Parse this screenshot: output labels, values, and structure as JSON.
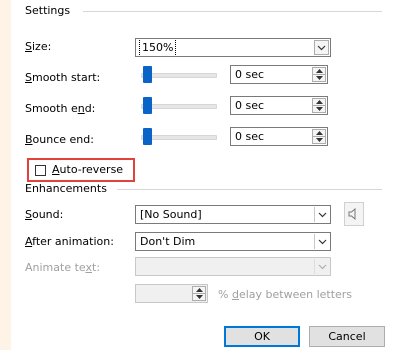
{
  "settings": {
    "group_label": "Settings",
    "size": {
      "label": "Size:",
      "value": "150%"
    },
    "smooth_start": {
      "label": "Smooth start:",
      "value": "0 sec",
      "level": 0
    },
    "smooth_end": {
      "label": "Smooth end:",
      "value": "0 sec",
      "level": 0
    },
    "bounce_end": {
      "label": "Bounce end:",
      "value": "0 sec",
      "level": 0
    },
    "auto_reverse": {
      "label": "Auto-reverse",
      "checked": false
    }
  },
  "enhancements": {
    "group_label": "Enhancements",
    "sound": {
      "label": "Sound:",
      "value": "[No Sound]"
    },
    "after_animation": {
      "label": "After animation:",
      "value": "Don't Dim"
    },
    "animate_text": {
      "label": "Animate text:",
      "value": "",
      "disabled": true
    },
    "delay": {
      "value": "",
      "label": "% delay between letters",
      "disabled": true
    }
  },
  "buttons": {
    "ok": "OK",
    "cancel": "Cancel"
  },
  "colors": {
    "accent": "#0078d7",
    "slider": "#0a64c8",
    "highlight": "#e0433c",
    "background": "#fdf3e7"
  }
}
